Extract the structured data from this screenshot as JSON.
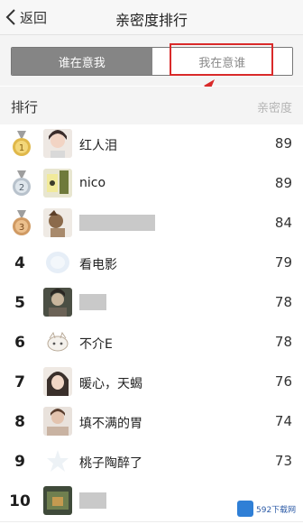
{
  "header": {
    "back_label": "返回",
    "title": "亲密度排行"
  },
  "tabs": [
    {
      "label": "谁在意我",
      "active": true
    },
    {
      "label": "我在意谁",
      "active": false
    }
  ],
  "list_header": {
    "left": "排行",
    "right": "亲密度"
  },
  "rows": [
    {
      "rank": "1",
      "medal": "gold",
      "name": "红人泪",
      "score": "89"
    },
    {
      "rank": "2",
      "medal": "silver",
      "name": "nico",
      "score": "89"
    },
    {
      "rank": "3",
      "medal": "bronze",
      "name": "",
      "score": "84"
    },
    {
      "rank": "4",
      "name": "看电影",
      "score": "79"
    },
    {
      "rank": "5",
      "name": "",
      "score": "78"
    },
    {
      "rank": "6",
      "name": "不介E",
      "score": "78"
    },
    {
      "rank": "7",
      "name": "暖心，天蝎",
      "score": "76"
    },
    {
      "rank": "8",
      "name": "填不满的胃",
      "score": "74"
    },
    {
      "rank": "9",
      "name": "桃子陶醉了",
      "score": "73"
    },
    {
      "rank": "10",
      "name": "",
      "score": ""
    }
  ],
  "watermark": {
    "text": "592下载网"
  },
  "colors": {
    "highlight": "#d92a2a",
    "active_tab": "#858585"
  }
}
